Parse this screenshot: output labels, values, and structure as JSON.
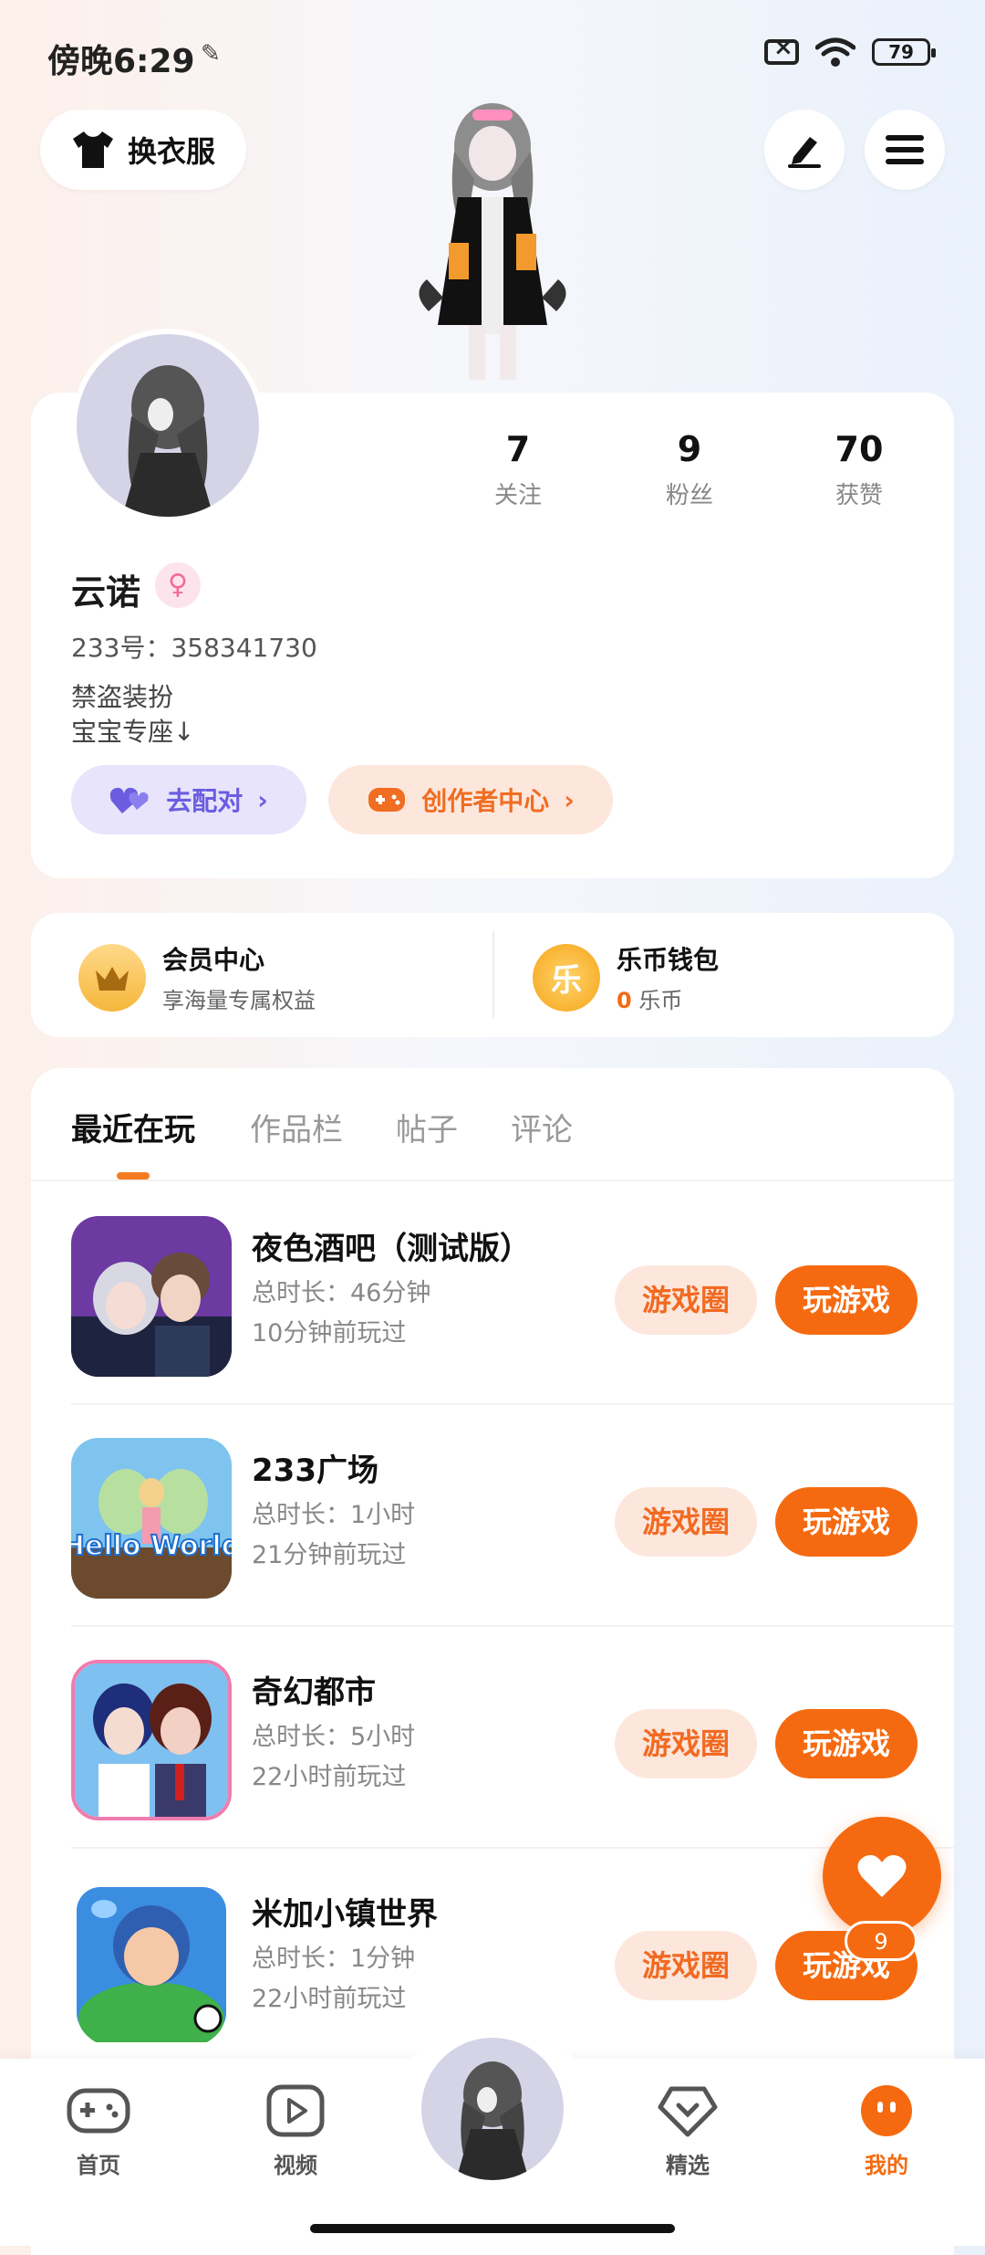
{
  "status_bar": {
    "time": "傍晚6:29",
    "battery": "79"
  },
  "header": {
    "outfit_label": "换衣服"
  },
  "profile": {
    "stats": [
      {
        "value": "7",
        "label": "关注"
      },
      {
        "value": "9",
        "label": "粉丝"
      },
      {
        "value": "70",
        "label": "获赞"
      }
    ],
    "username": "云诺",
    "gender_icon": "female-icon",
    "user_id": "233号：358341730",
    "bio_lines": [
      "禁盗装扮",
      "宝宝专座↓"
    ],
    "match_label": "去配对",
    "creator_label": "创作者中心"
  },
  "wallet": {
    "member_title": "会员中心",
    "member_sub": "享海量专属权益",
    "coin_icon_text": "乐",
    "coin_title": "乐币钱包",
    "coin_amount": "0",
    "coin_unit": "乐币"
  },
  "tabs": [
    "最近在玩",
    "作品栏",
    "帖子",
    "评论"
  ],
  "games": [
    {
      "title": "夜色酒吧（测试版）",
      "duration": "总时长：46分钟",
      "last_played": "10分钟前玩过",
      "circle_label": "游戏圈",
      "play_label": "玩游戏"
    },
    {
      "title": "233广场",
      "duration": "总时长：1小时",
      "last_played": "21分钟前玩过",
      "circle_label": "游戏圈",
      "play_label": "玩游戏",
      "icon_text": "Hello World"
    },
    {
      "title": "奇幻都市",
      "duration": "总时长：5小时",
      "last_played": "22小时前玩过",
      "circle_label": "游戏圈",
      "play_label": "玩游戏"
    },
    {
      "title": "米加小镇世界",
      "duration": "总时长：1分钟",
      "last_played": "22小时前玩过",
      "circle_label": "游戏圈",
      "play_label": "玩游戏"
    }
  ],
  "floating": {
    "count": "9"
  },
  "nav": {
    "home": "首页",
    "video": "视频",
    "featured": "精选",
    "mine": "我的"
  },
  "colors": {
    "accent": "#f56a10",
    "match": "#6b5ce0"
  }
}
